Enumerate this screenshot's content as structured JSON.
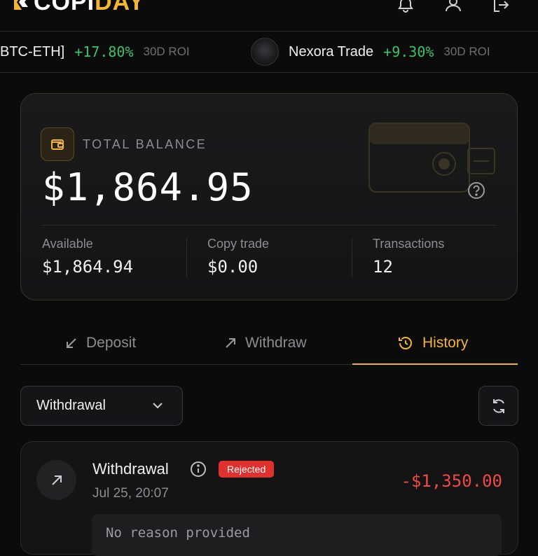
{
  "brand": {
    "part1": "COPI",
    "part2": "DAY",
    "accent": "#f2b632"
  },
  "header": {
    "icons": [
      "bell-icon",
      "user-icon",
      "logout-icon"
    ]
  },
  "ticker": [
    {
      "name": "BTC-ETH]",
      "change": "+17.80%",
      "period": "30D ROI"
    },
    {
      "name": "Nexora Trade",
      "change": "+9.30%",
      "period": "30D ROI"
    }
  ],
  "balance": {
    "label": "TOTAL BALANCE",
    "amount": "$1,864.95",
    "stats": [
      {
        "label": "Available",
        "value": "$1,864.94"
      },
      {
        "label": "Copy trade",
        "value": "$0.00"
      },
      {
        "label": "Transactions",
        "value": "12"
      }
    ]
  },
  "tabs": [
    {
      "label": "Deposit",
      "icon": "arrow-down-left-icon",
      "active": false
    },
    {
      "label": "Withdraw",
      "icon": "arrow-up-right-icon",
      "active": false
    },
    {
      "label": "History",
      "icon": "history-icon",
      "active": true
    }
  ],
  "filter": {
    "selected": "Withdrawal"
  },
  "transactions": [
    {
      "title": "Withdrawal",
      "status": "Rejected",
      "date": "Jul 25, 20:07",
      "amount": "-$1,350.00",
      "reason": "No reason provided"
    }
  ],
  "colors": {
    "positive": "#3cc36b",
    "negative": "#ef4a45",
    "badge_rejected": "#e0312f"
  }
}
